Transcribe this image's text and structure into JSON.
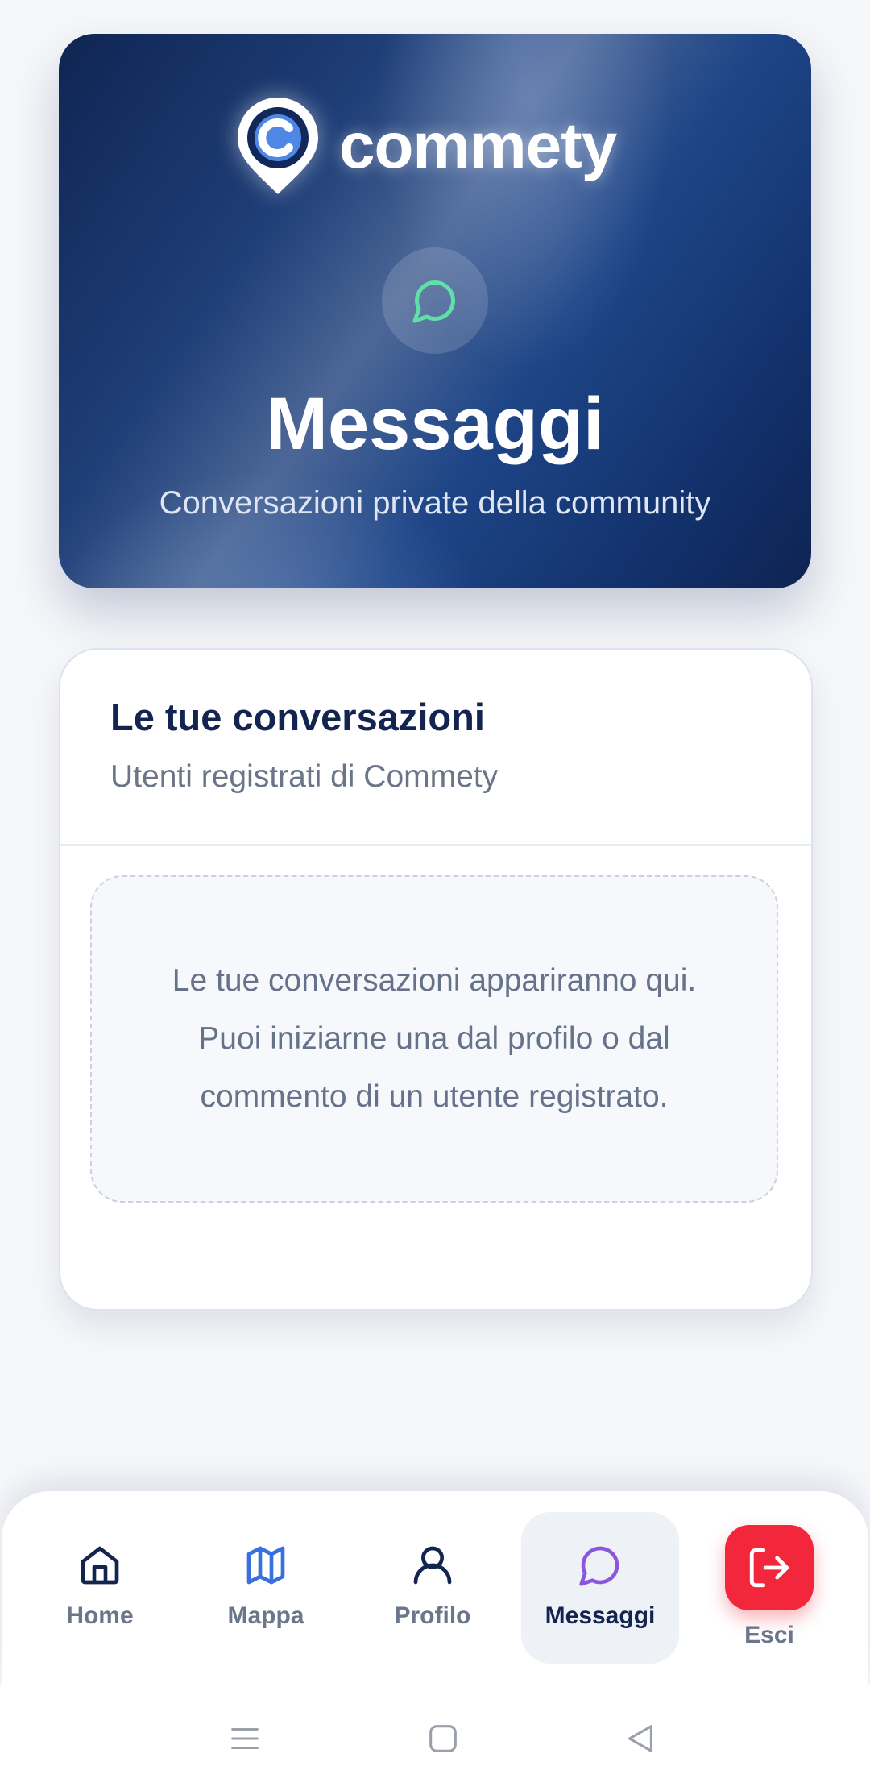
{
  "hero": {
    "brand": "commety",
    "title": "Messaggi",
    "subtitle": "Conversazioni private della community",
    "icon": "chat-bubble-icon"
  },
  "conversations": {
    "title": "Le tue conversazioni",
    "subtitle": "Utenti registrati di Commety",
    "empty_message": "Le tue conversazioni appariranno qui. Puoi iniziarne una dal profilo o dal commento di un utente registrato."
  },
  "bottom_nav": {
    "items": [
      {
        "label": "Home",
        "icon": "home-icon",
        "active": false
      },
      {
        "label": "Mappa",
        "icon": "map-icon",
        "active": false
      },
      {
        "label": "Profilo",
        "icon": "user-icon",
        "active": false
      },
      {
        "label": "Messaggi",
        "icon": "chat-bubble-icon",
        "active": true
      }
    ],
    "logout": {
      "label": "Esci",
      "icon": "logout-icon"
    }
  },
  "system_nav": {
    "buttons": [
      "menu-icon",
      "home-square-icon",
      "back-icon"
    ]
  },
  "colors": {
    "primary_navy": "#12244f",
    "accent_green": "#5fe0a8",
    "accent_purple": "#8a56e0",
    "map_blue": "#3a6fe0",
    "logout_red": "#f3273b"
  }
}
